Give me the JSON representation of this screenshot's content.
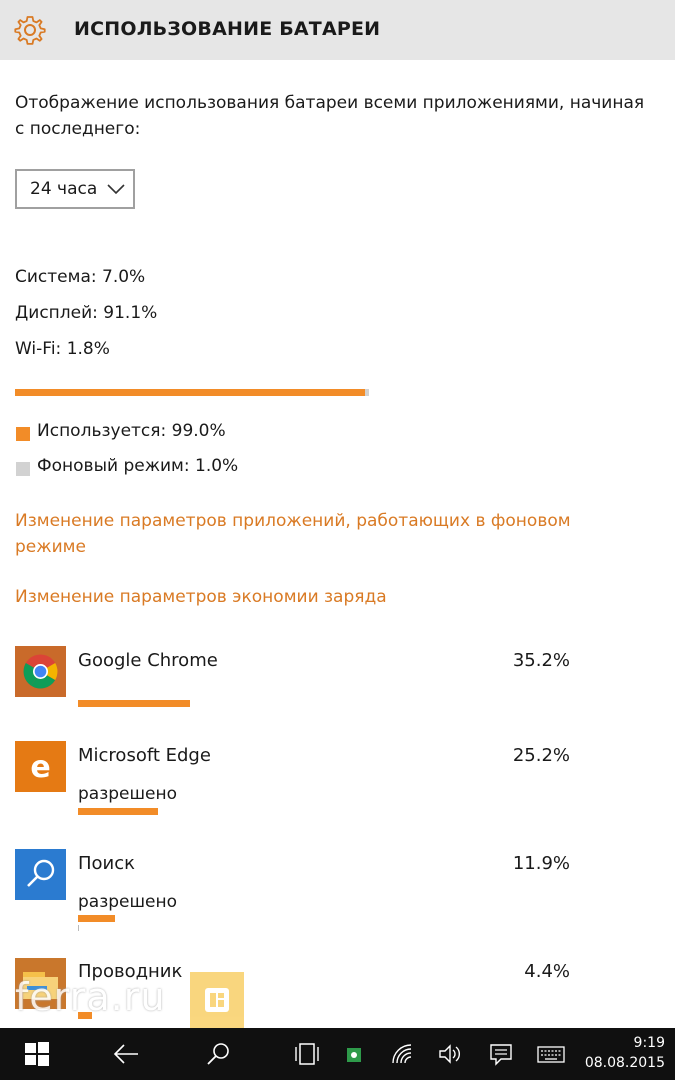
{
  "header": {
    "title": "ИСПОЛЬЗОВАНИЕ БАТАРЕИ",
    "icon": "gear-icon"
  },
  "description": "Отображение использования батареи всеми приложениями, начиная с последнего:",
  "period_select": {
    "value": "24 часа"
  },
  "stats": {
    "system": "Система: 7.0%",
    "display": "Дисплей: 91.1%",
    "wifi": "Wi-Fi: 1.8%"
  },
  "usage": {
    "foreground_fraction": 0.99,
    "fill_color": "#f28c28",
    "track_color": "#d2d2d2"
  },
  "legend": {
    "used": "Используется: 99.0%",
    "background": "Фоновый режим: 1.0%",
    "used_color": "#f28c28",
    "background_color": "#d2d2d2"
  },
  "links": {
    "background_apps": "Изменение параметров приложений, работающих в фоновом режиме",
    "battery_saver": "Изменение параметров экономии заряда"
  },
  "apps": [
    {
      "name": "Google Chrome",
      "percent": "35.2%",
      "status": "",
      "icon": "chrome-icon"
    },
    {
      "name": "Microsoft Edge",
      "percent": "25.2%",
      "status": "разрешено",
      "icon": "edge-icon"
    },
    {
      "name": "Поиск",
      "percent": "11.9%",
      "status": "разрешено",
      "icon": "search-app-icon"
    },
    {
      "name": "Проводник",
      "percent": "4.4%",
      "status": "",
      "icon": "file-explorer-icon"
    }
  ],
  "watermark": "ferra.ru",
  "taskbar": {
    "time": "9:19",
    "date": "08.08.2015",
    "icons": [
      "windows-start-icon",
      "back-arrow-icon",
      "search-icon",
      "task-view-icon",
      "store-badge-icon",
      "wifi-icon",
      "volume-icon",
      "action-center-icon",
      "keyboard-icon"
    ]
  },
  "colors": {
    "accent": "#f28c28",
    "link": "#d97a24",
    "header_bg": "#e6e6e6",
    "taskbar_bg": "#101010"
  }
}
